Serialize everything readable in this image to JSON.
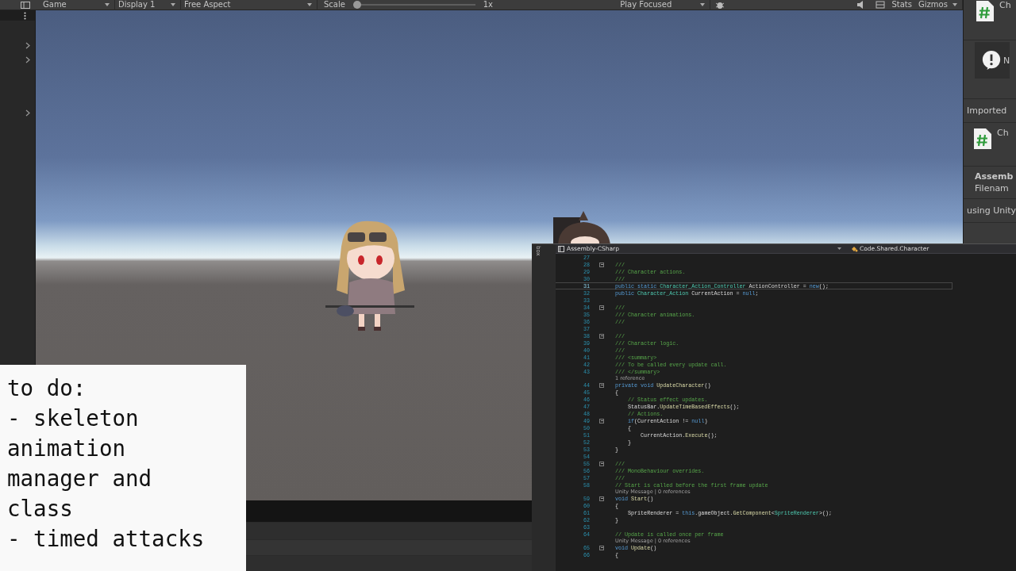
{
  "toolbar": {
    "items": [
      {
        "kind": "dropdown",
        "label": "Game"
      },
      {
        "kind": "dropdown",
        "label": "Display 1"
      },
      {
        "kind": "dropdown",
        "label": "Free Aspect"
      },
      {
        "kind": "slider",
        "label": "Scale",
        "level": 0.03,
        "reading": "1x"
      },
      {
        "kind": "spacer"
      },
      {
        "kind": "dropdown",
        "label": "Play Focused"
      },
      {
        "kind": "bug"
      },
      {
        "kind": "spacer"
      },
      {
        "kind": "mute"
      },
      {
        "kind": "stats"
      },
      {
        "kind": "text",
        "label": "Stats"
      },
      {
        "kind": "dropdown",
        "label": "Gizmos"
      }
    ]
  },
  "inspector": {
    "header_title": "Ch",
    "notice": "N",
    "section": "Imported",
    "asset_name": "Ch",
    "labels": [
      "Assemb",
      "Filenam"
    ],
    "preview": "using Unity"
  },
  "note": {
    "lines": [
      "to do:",
      "- skeleton",
      "animation",
      "manager and",
      "class",
      "- timed attacks"
    ]
  },
  "code_editor": {
    "side_tab": "box",
    "project": "Assembly-CSharp",
    "scope": "Code.Shared.Character",
    "rows": [
      {
        "kind": "code",
        "number": "27",
        "selected": false,
        "fold": false
      },
      {
        "kind": "code",
        "number": "28",
        "selected": false,
        "fold": true,
        "tokens": [
          {
            "text": "///",
            "kind": "comment"
          }
        ]
      },
      {
        "kind": "code",
        "number": "29",
        "selected": false,
        "fold": false,
        "tokens": [
          {
            "text": "/// Character actions.",
            "kind": "comment"
          }
        ]
      },
      {
        "kind": "code",
        "number": "30",
        "selected": false,
        "fold": false,
        "tokens": [
          {
            "text": "///",
            "kind": "comment"
          }
        ]
      },
      {
        "kind": "code",
        "number": "31",
        "selected": true,
        "fold": false,
        "tokens": [
          {
            "text": "public static ",
            "kind": "keyword"
          },
          {
            "text": "Character_Action_Controller",
            "kind": "type"
          },
          {
            "text": " ActionController = ",
            "kind": "plain"
          },
          {
            "text": "new",
            "kind": "keyword"
          },
          {
            "text": "();",
            "kind": "plain"
          }
        ]
      },
      {
        "kind": "code",
        "number": "32",
        "selected": false,
        "fold": false,
        "tokens": [
          {
            "text": "public ",
            "kind": "keyword"
          },
          {
            "text": "Character_Action",
            "kind": "type"
          },
          {
            "text": " CurrentAction = ",
            "kind": "plain"
          },
          {
            "text": "null",
            "kind": "keyword"
          },
          {
            "text": ";",
            "kind": "plain"
          }
        ]
      },
      {
        "kind": "code",
        "number": "33",
        "selected": false,
        "fold": false
      },
      {
        "kind": "code",
        "number": "34",
        "selected": false,
        "fold": true,
        "tokens": [
          {
            "text": "///",
            "kind": "comment"
          }
        ]
      },
      {
        "kind": "code",
        "number": "35",
        "selected": false,
        "fold": false,
        "tokens": [
          {
            "text": "/// Character animations.",
            "kind": "comment"
          }
        ]
      },
      {
        "kind": "code",
        "number": "36",
        "selected": false,
        "fold": false,
        "tokens": [
          {
            "text": "///",
            "kind": "comment"
          }
        ]
      },
      {
        "kind": "code",
        "number": "37",
        "selected": false,
        "fold": false
      },
      {
        "kind": "code",
        "number": "38",
        "selected": false,
        "fold": true,
        "tokens": [
          {
            "text": "///",
            "kind": "comment"
          }
        ]
      },
      {
        "kind": "code",
        "number": "39",
        "selected": false,
        "fold": false,
        "tokens": [
          {
            "text": "/// Character logic.",
            "kind": "comment"
          }
        ]
      },
      {
        "kind": "code",
        "number": "40",
        "selected": false,
        "fold": false,
        "tokens": [
          {
            "text": "///",
            "kind": "comment"
          }
        ]
      },
      {
        "kind": "code",
        "number": "41",
        "selected": false,
        "fold": false,
        "tokens": [
          {
            "text": "/// <summary>",
            "kind": "comment"
          }
        ]
      },
      {
        "kind": "code",
        "number": "42",
        "selected": false,
        "fold": false,
        "tokens": [
          {
            "text": "/// To be called every update call.",
            "kind": "comment"
          }
        ]
      },
      {
        "kind": "code",
        "number": "43",
        "selected": false,
        "fold": false,
        "tokens": [
          {
            "text": "/// </summary>",
            "kind": "comment"
          }
        ]
      },
      {
        "kind": "lens",
        "text": "1 reference"
      },
      {
        "kind": "code",
        "number": "44",
        "selected": false,
        "fold": true,
        "tokens": [
          {
            "text": "private void ",
            "kind": "keyword"
          },
          {
            "text": "UpdateCharacter",
            "kind": "method"
          },
          {
            "text": "()",
            "kind": "plain"
          }
        ]
      },
      {
        "kind": "code",
        "number": "45",
        "selected": false,
        "fold": false,
        "tokens": [
          {
            "text": "{",
            "kind": "plain"
          }
        ]
      },
      {
        "kind": "code",
        "number": "46",
        "selected": false,
        "fold": false,
        "tokens": [
          {
            "text": "    // Status effect updates.",
            "kind": "comment"
          }
        ]
      },
      {
        "kind": "code",
        "number": "47",
        "selected": false,
        "fold": false,
        "tokens": [
          {
            "text": "    StatusBar.",
            "kind": "plain"
          },
          {
            "text": "UpdateTimeBasedEffects",
            "kind": "method"
          },
          {
            "text": "();",
            "kind": "plain"
          }
        ]
      },
      {
        "kind": "code",
        "number": "48",
        "selected": false,
        "fold": false,
        "tokens": [
          {
            "text": "    // Actions.",
            "kind": "comment"
          }
        ]
      },
      {
        "kind": "code",
        "number": "49",
        "selected": false,
        "fold": true,
        "tokens": [
          {
            "text": "    if",
            "kind": "keyword"
          },
          {
            "text": "(CurrentAction != ",
            "kind": "plain"
          },
          {
            "text": "null",
            "kind": "keyword"
          },
          {
            "text": ")",
            "kind": "plain"
          }
        ]
      },
      {
        "kind": "code",
        "number": "50",
        "selected": false,
        "fold": false,
        "tokens": [
          {
            "text": "    {",
            "kind": "plain"
          }
        ]
      },
      {
        "kind": "code",
        "number": "51",
        "selected": false,
        "fold": false,
        "tokens": [
          {
            "text": "        CurrentAction.",
            "kind": "plain"
          },
          {
            "text": "Execute",
            "kind": "method"
          },
          {
            "text": "();",
            "kind": "plain"
          }
        ]
      },
      {
        "kind": "code",
        "number": "52",
        "selected": false,
        "fold": false,
        "tokens": [
          {
            "text": "    }",
            "kind": "plain"
          }
        ]
      },
      {
        "kind": "code",
        "number": "53",
        "selected": false,
        "fold": false,
        "tokens": [
          {
            "text": "}",
            "kind": "plain"
          }
        ]
      },
      {
        "kind": "code",
        "number": "54",
        "selected": false,
        "fold": false
      },
      {
        "kind": "code",
        "number": "55",
        "selected": false,
        "fold": true,
        "tokens": [
          {
            "text": "///",
            "kind": "comment"
          }
        ]
      },
      {
        "kind": "code",
        "number": "56",
        "selected": false,
        "fold": false,
        "tokens": [
          {
            "text": "/// MonoBehaviour overrides.",
            "kind": "comment"
          }
        ]
      },
      {
        "kind": "code",
        "number": "57",
        "selected": false,
        "fold": false,
        "tokens": [
          {
            "text": "///",
            "kind": "comment"
          }
        ]
      },
      {
        "kind": "code",
        "number": "58",
        "selected": false,
        "fold": false,
        "tokens": [
          {
            "text": "// Start is called before the first frame update",
            "kind": "comment"
          }
        ]
      },
      {
        "kind": "lens",
        "text": "Unity Message | 0 references"
      },
      {
        "kind": "code",
        "number": "59",
        "selected": false,
        "fold": true,
        "tokens": [
          {
            "text": "void ",
            "kind": "keyword"
          },
          {
            "text": "Start",
            "kind": "method"
          },
          {
            "text": "()",
            "kind": "plain"
          }
        ]
      },
      {
        "kind": "code",
        "number": "60",
        "selected": false,
        "fold": false,
        "tokens": [
          {
            "text": "{",
            "kind": "plain"
          }
        ]
      },
      {
        "kind": "code",
        "number": "61",
        "selected": false,
        "fold": false,
        "tokens": [
          {
            "text": "    SpriteRenderer = ",
            "kind": "plain"
          },
          {
            "text": "this",
            "kind": "keyword"
          },
          {
            "text": ".gameObject.",
            "kind": "plain"
          },
          {
            "text": "GetComponent",
            "kind": "method"
          },
          {
            "text": "<",
            "kind": "plain"
          },
          {
            "text": "SpriteRenderer",
            "kind": "type"
          },
          {
            "text": ">();",
            "kind": "plain"
          }
        ]
      },
      {
        "kind": "code",
        "number": "62",
        "selected": false,
        "fold": false,
        "tokens": [
          {
            "text": "}",
            "kind": "plain"
          }
        ]
      },
      {
        "kind": "code",
        "number": "63",
        "selected": false,
        "fold": false
      },
      {
        "kind": "code",
        "number": "64",
        "selected": false,
        "fold": false,
        "tokens": [
          {
            "text": "// Update is called once per frame",
            "kind": "comment"
          }
        ]
      },
      {
        "kind": "lens",
        "text": "Unity Message | 0 references"
      },
      {
        "kind": "code",
        "number": "65",
        "selected": false,
        "fold": true,
        "tokens": [
          {
            "text": "void ",
            "kind": "keyword"
          },
          {
            "text": "Update",
            "kind": "method"
          },
          {
            "text": "()",
            "kind": "plain"
          }
        ]
      },
      {
        "kind": "code",
        "number": "66",
        "selected": false,
        "fold": false,
        "tokens": [
          {
            "text": "{",
            "kind": "plain"
          }
        ]
      }
    ]
  }
}
